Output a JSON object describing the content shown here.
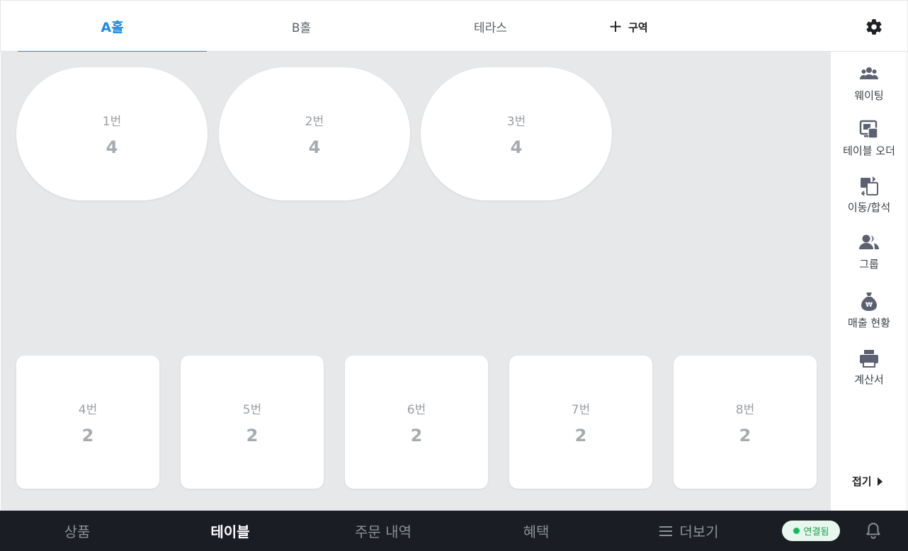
{
  "top_tabs": [
    {
      "label": "A홀"
    },
    {
      "label": "B홀"
    },
    {
      "label": "테라스"
    }
  ],
  "add_zone_label": "구역",
  "floor": {
    "oval_tables": [
      {
        "name": "1번",
        "seats": "4"
      },
      {
        "name": "2번",
        "seats": "4"
      },
      {
        "name": "3번",
        "seats": "4"
      }
    ],
    "rect_tables": [
      {
        "name": "4번",
        "seats": "2"
      },
      {
        "name": "5번",
        "seats": "2"
      },
      {
        "name": "6번",
        "seats": "2"
      },
      {
        "name": "7번",
        "seats": "2"
      },
      {
        "name": "8번",
        "seats": "2"
      }
    ]
  },
  "sidebar": {
    "items": [
      {
        "label": "웨이팅",
        "icon": "people-icon"
      },
      {
        "label": "테이블 오더",
        "icon": "table-order-icon"
      },
      {
        "label": "이동/합석",
        "icon": "move-merge-icon"
      },
      {
        "label": "그룹",
        "icon": "group-icon"
      },
      {
        "label": "매출 현황",
        "icon": "money-bag-icon"
      },
      {
        "label": "계산서",
        "icon": "printer-icon"
      }
    ],
    "collapse_label": "접기"
  },
  "bottom_nav": [
    {
      "label": "상품"
    },
    {
      "label": "테이블"
    },
    {
      "label": "주문 내역"
    },
    {
      "label": "혜택"
    },
    {
      "label": "더보기"
    }
  ],
  "connection_status": "연결됨",
  "colors": {
    "accent": "#1c8be6",
    "floor_bg": "#e6e8ea",
    "bottom_bar": "#1b1d25",
    "connected": "#18b85a"
  }
}
